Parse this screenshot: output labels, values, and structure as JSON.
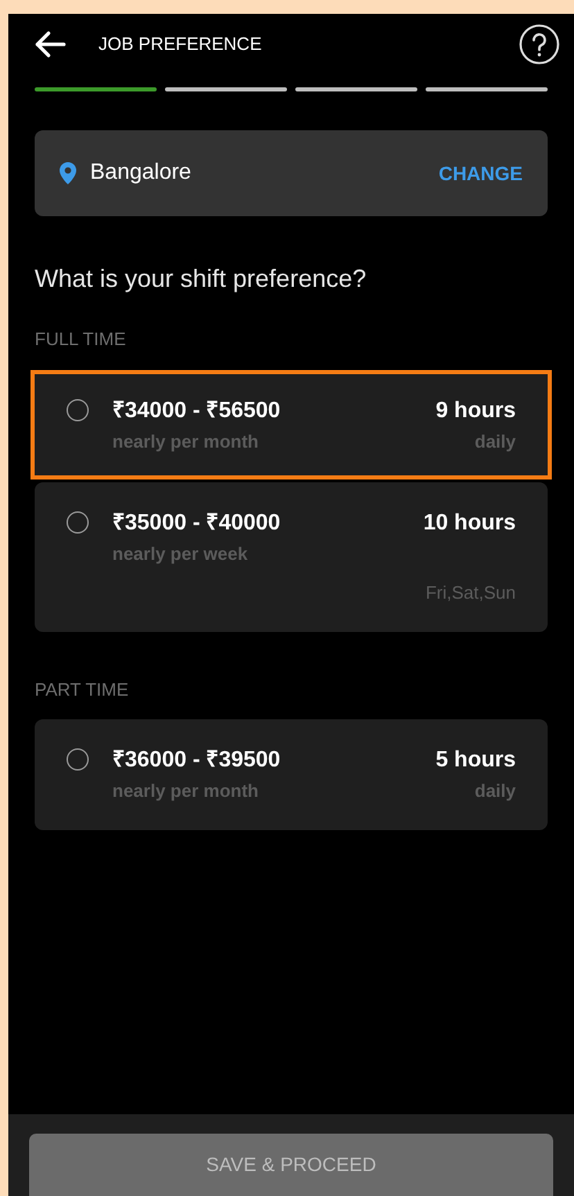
{
  "header": {
    "title": "JOB PREFERENCE"
  },
  "steps": [
    {
      "active": true
    },
    {
      "active": false
    },
    {
      "active": false
    },
    {
      "active": false
    }
  ],
  "location": {
    "city": "Bangalore",
    "action": "CHANGE"
  },
  "question": "What is your shift preference?",
  "sections": [
    {
      "title": "FULL TIME",
      "options": [
        {
          "salary": "₹34000 - ₹56500",
          "period": "nearly per month",
          "hours": "9 hours",
          "schedule": "daily",
          "selected": false,
          "highlighted": true
        },
        {
          "salary": "₹35000 - ₹40000",
          "period": "nearly per week",
          "hours": "10 hours",
          "days": "Fri,Sat,Sun",
          "selected": false,
          "highlighted": false
        }
      ]
    },
    {
      "title": "PART TIME",
      "options": [
        {
          "salary": "₹36000 - ₹39500",
          "period": "nearly per month",
          "hours": "5 hours",
          "schedule": "daily",
          "selected": false,
          "highlighted": false
        }
      ]
    }
  ],
  "footer": {
    "button": "SAVE & PROCEED",
    "disabled": true
  }
}
